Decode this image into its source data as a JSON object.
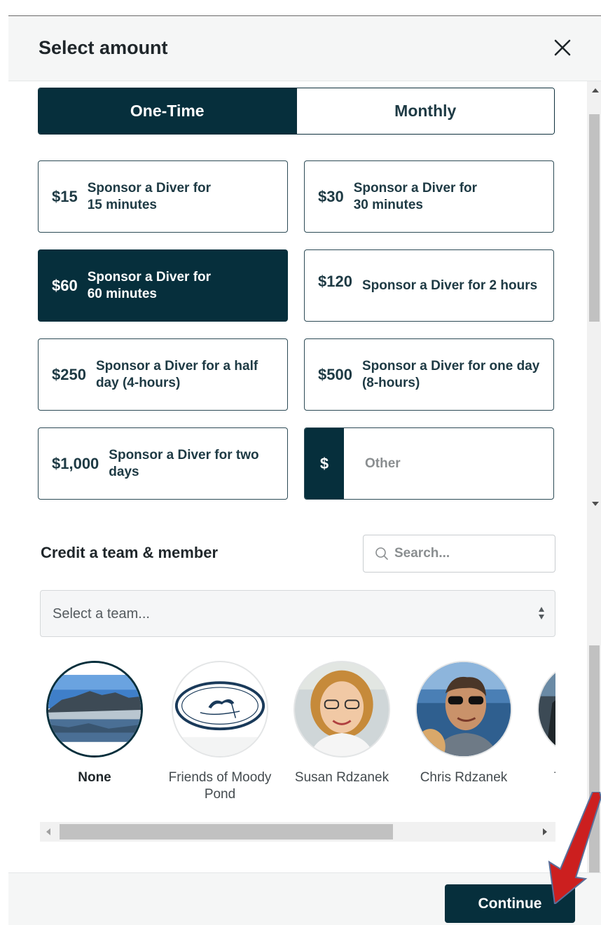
{
  "modal": {
    "title": "Select amount",
    "close_icon": "close-icon"
  },
  "frequency": {
    "options": [
      "One-Time",
      "Monthly"
    ],
    "selected": "One-Time"
  },
  "amounts": [
    {
      "price": "$15",
      "label": "Sponsor a Diver for 15 minutes",
      "selected": false
    },
    {
      "price": "$30",
      "label": "Sponsor a Diver for 30 minutes",
      "selected": false
    },
    {
      "price": "$60",
      "label": "Sponsor a Diver for 60 minutes",
      "selected": true
    },
    {
      "price": "$120",
      "label": "Sponsor a Diver for 2 hours",
      "selected": false
    },
    {
      "price": "$250",
      "label": "Sponsor a Diver for a half day (4-hours)",
      "selected": false
    },
    {
      "price": "$500",
      "label": "Sponsor a Diver for one day (8-hours)",
      "selected": false
    },
    {
      "price": "$1,000",
      "label": "Sponsor a Diver for two days",
      "selected": false
    }
  ],
  "other_amount": {
    "symbol": "$",
    "placeholder": "Other",
    "value": ""
  },
  "credit": {
    "label": "Credit a team & member",
    "search_placeholder": "Search...",
    "team_select_value": "Select a team...",
    "members": [
      {
        "name": "None",
        "selected": true
      },
      {
        "name": "Friends of Moody Pond",
        "selected": false
      },
      {
        "name": "Susan Rdzanek",
        "selected": false
      },
      {
        "name": "Chris Rdzanek",
        "selected": false
      },
      {
        "name": "Trist",
        "selected": false
      }
    ]
  },
  "footer": {
    "continue_label": "Continue"
  },
  "colors": {
    "primary": "#062f3c",
    "annotation_arrow": "#cc1f1f"
  }
}
